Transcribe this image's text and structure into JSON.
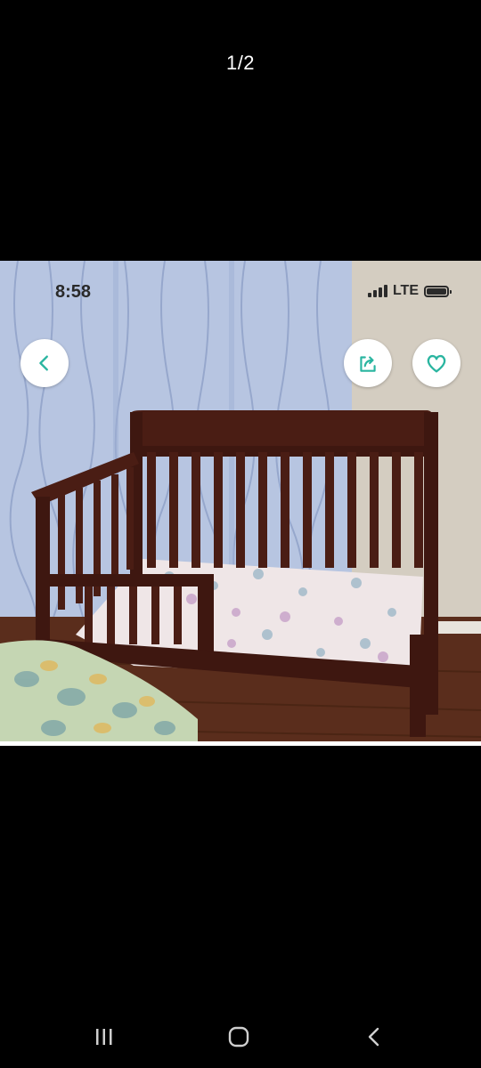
{
  "viewer": {
    "counter": "1/2",
    "back_button_icon": "chevron-left-icon",
    "share_button_icon": "share-icon",
    "favorite_button_icon": "heart-outline-icon",
    "accent_color": "#2ab5a0"
  },
  "photo": {
    "description_icon": "photo",
    "status_time": "8:58",
    "status_network": "LTE"
  },
  "system_nav": {
    "recent_icon": "recent-apps-icon",
    "home_icon": "home-icon",
    "back_icon": "back-icon"
  }
}
